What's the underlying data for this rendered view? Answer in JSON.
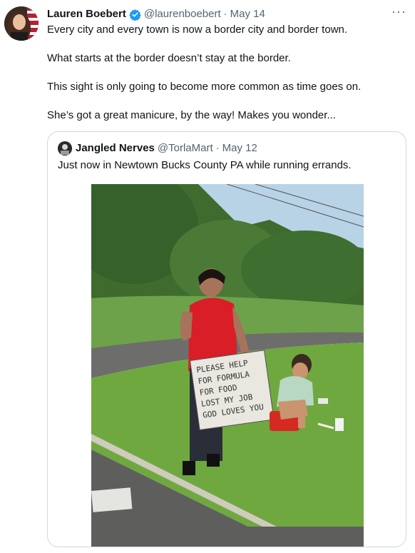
{
  "tweet": {
    "author_name": "Lauren Boebert",
    "author_handle": "@laurenboebert",
    "separator": "·",
    "date": "May 14",
    "more_glyph": "···",
    "paragraphs": [
      "Every city and every town is now a border city and border town.",
      "What starts at the border doesn’t stay at the border.",
      "This sight is only going to become more common as time goes on.",
      "She’s got a great manicure, by the way! Makes you wonder..."
    ]
  },
  "quoted_tweet": {
    "author_name": "Jangled Nerves",
    "author_handle": "@TorlaMart",
    "separator": "·",
    "date": "May 12",
    "text": "Just now in Newtown Bucks County PA while running errands."
  },
  "photo": {
    "sign_lines": [
      "PLEASE HELP",
      "FOR FORMULA",
      "FOR FOOD",
      "LOST MY JOB",
      "GOD LOVES YOU"
    ]
  },
  "colors": {
    "verified_blue": "#1d9bf0",
    "text_secondary": "#536471",
    "border": "#cfd9de"
  }
}
